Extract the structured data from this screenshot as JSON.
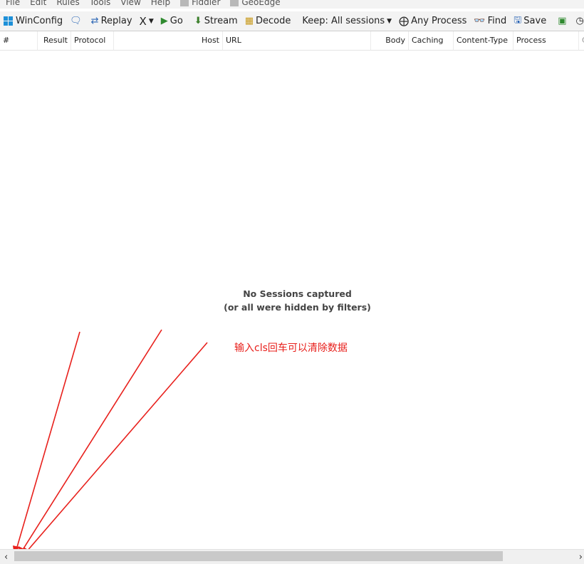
{
  "menu": {
    "items": [
      "File",
      "Edit",
      "Rules",
      "Tools",
      "View",
      "Help",
      "Fiddler",
      "GeoEdge"
    ]
  },
  "toolbar": {
    "winconfig": "WinConfig",
    "replay": "Replay",
    "remove": "X",
    "go": "Go",
    "stream": "Stream",
    "decode": "Decode",
    "keep": "Keep: All sessions",
    "any_process": "Any Process",
    "find": "Find",
    "save": "Save"
  },
  "columns": {
    "num": "#",
    "result": "Result",
    "protocol": "Protocol",
    "host": "Host",
    "url": "URL",
    "body": "Body",
    "caching": "Caching",
    "content_type": "Content-Type",
    "process": "Process",
    "extra": "C"
  },
  "empty_state": {
    "line1": "No Sessions captured",
    "line2": "(or all were hidden by filters)"
  },
  "annotation": {
    "text": "输入cls回车可以清除数据",
    "color": "#e8201c"
  },
  "scrollbar": {
    "left_arrow": "‹",
    "right_arrow": "›"
  },
  "colors": {
    "accent_blue": "#1e90d8",
    "annotation_red": "#e8201c",
    "toolbar_bg": "#f3f3f3"
  }
}
